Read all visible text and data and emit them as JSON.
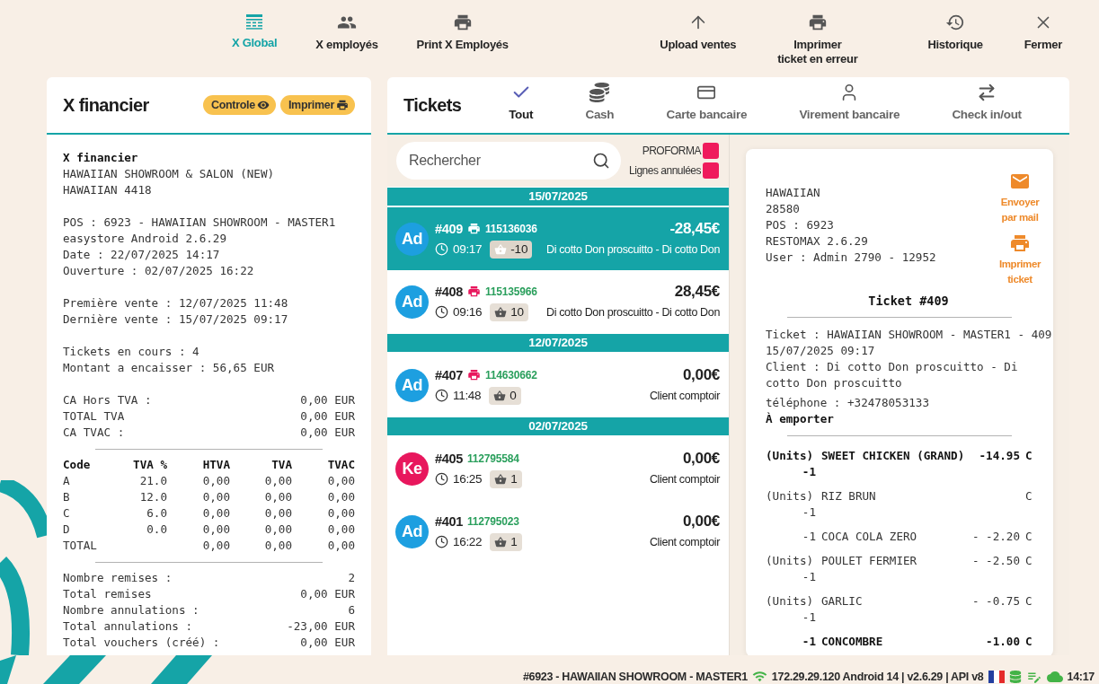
{
  "toolbar": {
    "left": [
      {
        "label": "X Global",
        "selected": true
      },
      {
        "label": "X employés",
        "selected": false
      },
      {
        "label": "Print X Employés",
        "selected": false
      }
    ],
    "right": [
      {
        "label": "Upload ventes",
        "selected": false
      },
      {
        "label": "Imprimer\nticket en erreur",
        "selected": false
      },
      {
        "label": "Historique",
        "selected": false
      },
      {
        "label": "Fermer",
        "selected": false
      }
    ]
  },
  "report": {
    "title": "X financier",
    "buttons": [
      {
        "label": "Controle"
      },
      {
        "label": "Imprimer"
      }
    ],
    "receipt": {
      "title": "X financier",
      "blocks": [
        {
          "kind": "lines",
          "lines": [
            "HAWAIIAN SHOWROOM & SALON (NEW)",
            "HAWAIIAN 4418"
          ]
        },
        {
          "kind": "lines",
          "lines": [
            "POS : 6923 - HAWAIIAN SHOWROOM - MASTER1",
            "easystore Android 2.6.29",
            "Date : 22/07/2025 14:17",
            "Ouverture : 02/07/2025 16:22"
          ]
        },
        {
          "kind": "lines",
          "lines": [
            "Première vente : 12/07/2025 11:48",
            "Dernière vente : 15/07/2025 09:17"
          ]
        },
        {
          "kind": "lines",
          "lines": [
            "Tickets en cours : 4",
            "Montant a encaisser : 56,65 EUR"
          ]
        },
        {
          "kind": "pairs",
          "rows": [
            {
              "label": "CA Hors TVA :",
              "value": "0,00 EUR"
            },
            {
              "label": "TOTAL TVA",
              "value": "0,00 EUR"
            },
            {
              "label": "CA TVAC :",
              "value": "0,00 EUR"
            }
          ]
        },
        {
          "kind": "rule"
        },
        {
          "kind": "table",
          "columns": [
            "Code",
            "TVA %",
            "HTVA",
            "TVA",
            "TVAC"
          ],
          "rows": [
            {
              "code": "A",
              "rate": "21.0",
              "htva": "0,00",
              "tva": "0,00",
              "tvac": "0,00"
            },
            {
              "code": "B",
              "rate": "12.0",
              "htva": "0,00",
              "tva": "0,00",
              "tvac": "0,00"
            },
            {
              "code": "C",
              "rate": "6.0",
              "htva": "0,00",
              "tva": "0,00",
              "tvac": "0,00"
            },
            {
              "code": "D",
              "rate": "0.0",
              "htva": "0,00",
              "tva": "0,00",
              "tvac": "0,00"
            },
            {
              "code": "TOTAL",
              "htva": "0,00",
              "tva": "0,00",
              "tvac": "0,00"
            }
          ]
        },
        {
          "kind": "rule"
        },
        {
          "kind": "pairs",
          "rows": [
            {
              "label": "Nombre remises :",
              "value": "2"
            },
            {
              "label": "Total remises",
              "value": "0,00 EUR"
            },
            {
              "label": "Nombre annulations :",
              "value": "6"
            },
            {
              "label": "Total annulations :",
              "value": "-23,00 EUR"
            },
            {
              "label": "Total vouchers (créé) :",
              "value": "0,00 EUR"
            }
          ]
        }
      ]
    }
  },
  "tickets": {
    "title": "Tickets",
    "tabs": [
      {
        "label": "Tout",
        "selected": true
      },
      {
        "label": "Cash",
        "selected": false
      },
      {
        "label": "Carte bancaire",
        "selected": false
      },
      {
        "label": "Virement bancaire",
        "selected": false
      },
      {
        "label": "Check in/out",
        "selected": false
      }
    ],
    "search": {
      "placeholder": "Rechercher"
    },
    "legend": [
      {
        "label": "PROFORMA"
      },
      {
        "label": "Lignes annulées"
      }
    ],
    "groups": [
      {
        "date": "15/07/2025",
        "tickets": [
          {
            "number": "#409",
            "printed": true,
            "ref": "115136036",
            "amount": "-28,45€",
            "time": "09:17",
            "count": "-10",
            "customer": "Di cotto Don proscuitto - Di cotto Don",
            "avatar": {
              "initials": "Ad",
              "color": "#1d9fe0"
            },
            "selected": true
          },
          {
            "number": "#408",
            "printed": true,
            "ref": "115135966",
            "amount": "28,45€",
            "time": "09:16",
            "count": "10",
            "customer": "Di cotto Don proscuitto - Di cotto Don",
            "avatar": {
              "initials": "Ad",
              "color": "#1d9fe0"
            },
            "selected": false
          }
        ]
      },
      {
        "date": "12/07/2025",
        "tickets": [
          {
            "number": "#407",
            "printed": true,
            "ref": "114630662",
            "amount": "0,00€",
            "time": "11:48",
            "count": "0",
            "customer": "Client comptoir",
            "avatar": {
              "initials": "Ad",
              "color": "#1d9fe0"
            },
            "selected": false
          }
        ]
      },
      {
        "date": "02/07/2025",
        "tickets": [
          {
            "number": "#405",
            "printed": false,
            "ref": "112795584",
            "amount": "0,00€",
            "time": "16:25",
            "count": "1",
            "customer": "Client comptoir",
            "avatar": {
              "initials": "Ke",
              "color": "#e8175d"
            },
            "selected": false
          },
          {
            "number": "#401",
            "printed": false,
            "ref": "112795023",
            "amount": "0,00€",
            "time": "16:22",
            "count": "1",
            "customer": "Client comptoir",
            "avatar": {
              "initials": "Ad",
              "color": "#1d9fe0"
            },
            "selected": false
          }
        ]
      }
    ]
  },
  "preview": {
    "header_lines": [
      "HAWAIIAN",
      "28580",
      "POS : 6923",
      "RESTOMAX 2.6.29",
      "User : Admin 2790 - 12952"
    ],
    "actions": [
      {
        "label": "Envoyer\npar mail"
      },
      {
        "label": "Imprimer\nticket"
      }
    ],
    "title": "Ticket #409",
    "details": [
      {
        "text": "Ticket : HAWAIIAN SHOWROOM - MASTER1 - 409",
        "bold": false
      },
      {
        "text": "15/07/2025 09:17",
        "bold": false
      },
      {
        "text": "Client : Di cotto Don proscuitto - Di",
        "bold": false
      },
      {
        "text": "cotto Don proscuitto",
        "bold": false
      },
      {
        "text": "téléphone : +32478053133",
        "bold": false
      },
      {
        "text": "À emporter",
        "bold": true
      }
    ],
    "items": [
      {
        "unit": "(Units)",
        "qty": "-1",
        "name": "SWEET CHICKEN (GRAND)",
        "price": "-14.95",
        "code": "C",
        "bold": true
      },
      {
        "unit": "(Units)",
        "qty": "-1",
        "name": "RIZ BRUN",
        "code": "C",
        "bold": false
      },
      {
        "qty": "-1",
        "name": "COCA COLA ZERO",
        "price": "- -2.20",
        "code": "C",
        "bold": false
      },
      {
        "unit": "(Units)",
        "qty": "-1",
        "name": "POULET FERMIER",
        "price": "- -2.50",
        "code": "C",
        "bold": false
      },
      {
        "unit": "(Units)",
        "qty": "-1",
        "name": "GARLIC",
        "price": "- -0.75",
        "code": "C",
        "bold": false
      },
      {
        "qty": "-1",
        "name": "CONCOMBRE",
        "price": "-1.00",
        "code": "C",
        "bold": true
      }
    ]
  },
  "status_bar": {
    "pos": "#6923 - HAWAIIAN SHOWROOM - MASTER1",
    "device_info": "172.29.29.120 Android 14 | v2.6.29 | API v8",
    "time": "14:17"
  }
}
